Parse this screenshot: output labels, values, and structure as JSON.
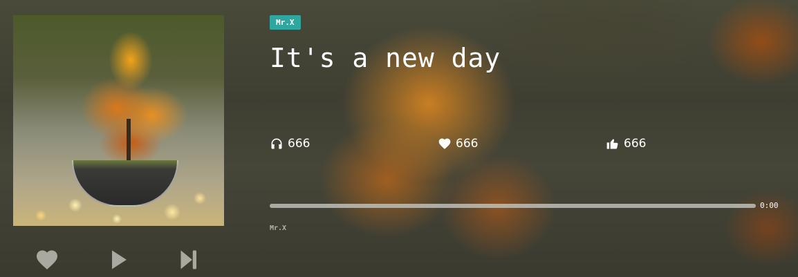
{
  "player": {
    "artist_tag": "Mr.X",
    "track_title": "It's a new day",
    "artist_caption": "Mr.X",
    "stats": {
      "listens": "666",
      "favorites": "666",
      "likes": "666"
    },
    "progress": {
      "fraction": 0.0,
      "time": "0:00"
    }
  },
  "controls": {
    "favorite": "heart-icon",
    "play": "play-icon",
    "next": "skip-next-icon"
  },
  "colors": {
    "tag_bg": "#2fa6a0",
    "progress_track": "#bebeb9",
    "controls": "#a9a9a0"
  }
}
